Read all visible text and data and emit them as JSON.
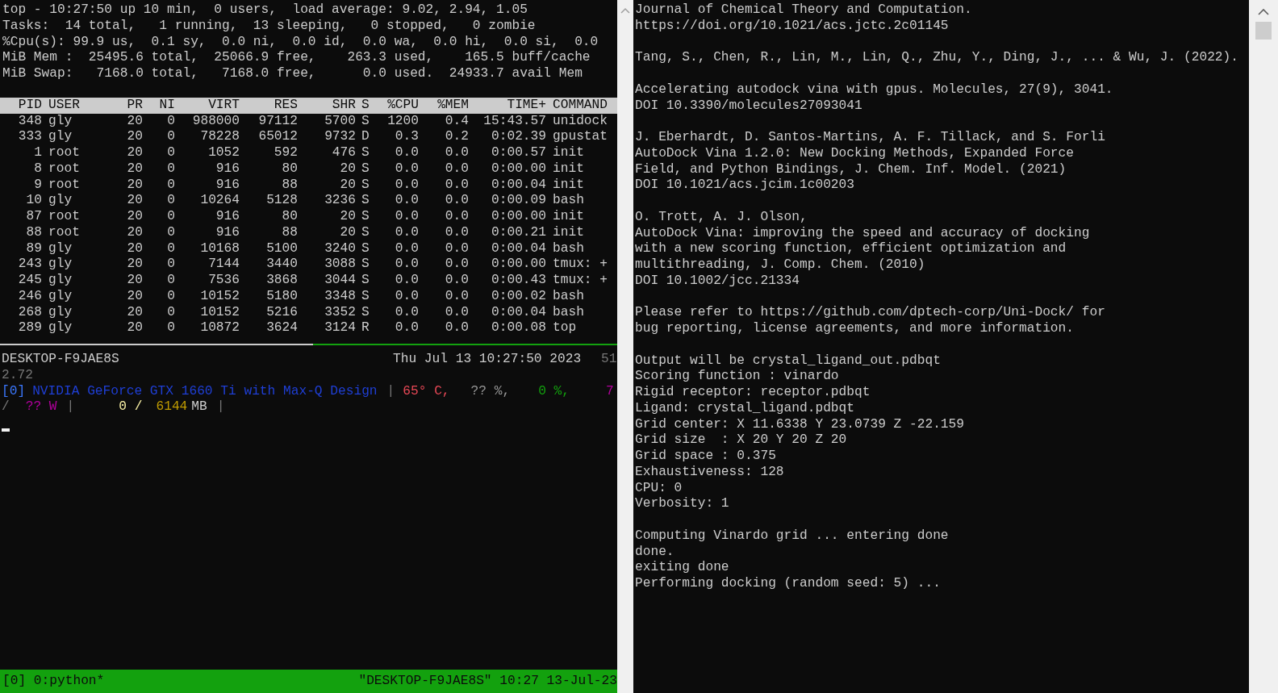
{
  "top_pane": {
    "summary": [
      "top - 10:27:50 up 10 min,  0 users,  load average: 9.02, 2.94, 1.05",
      "Tasks:  14 total,   1 running,  13 sleeping,   0 stopped,   0 zombie",
      "%Cpu(s): 99.9 us,  0.1 sy,  0.0 ni,  0.0 id,  0.0 wa,  0.0 hi,  0.0 si,  0.0",
      "MiB Mem :  25495.6 total,  25066.9 free,    263.3 used,    165.5 buff/cache",
      "MiB Swap:   7168.0 total,   7168.0 free,      0.0 used.  24933.7 avail Mem"
    ],
    "table": {
      "columns": [
        "PID",
        "USER",
        "PR",
        "NI",
        "VIRT",
        "RES",
        "SHR",
        "S",
        "%CPU",
        "%MEM",
        "TIME+",
        "COMMAND"
      ],
      "rows": [
        [
          "348",
          "gly",
          "20",
          "0",
          "988000",
          "97112",
          "5700",
          "S",
          "1200",
          "0.4",
          "15:43.57",
          "unidock"
        ],
        [
          "333",
          "gly",
          "20",
          "0",
          "78228",
          "65012",
          "9732",
          "D",
          "0.3",
          "0.2",
          "0:02.39",
          "gpustat"
        ],
        [
          "1",
          "root",
          "20",
          "0",
          "1052",
          "592",
          "476",
          "S",
          "0.0",
          "0.0",
          "0:00.57",
          "init"
        ],
        [
          "8",
          "root",
          "20",
          "0",
          "916",
          "80",
          "20",
          "S",
          "0.0",
          "0.0",
          "0:00.00",
          "init"
        ],
        [
          "9",
          "root",
          "20",
          "0",
          "916",
          "88",
          "20",
          "S",
          "0.0",
          "0.0",
          "0:00.04",
          "init"
        ],
        [
          "10",
          "gly",
          "20",
          "0",
          "10264",
          "5128",
          "3236",
          "S",
          "0.0",
          "0.0",
          "0:00.09",
          "bash"
        ],
        [
          "87",
          "root",
          "20",
          "0",
          "916",
          "80",
          "20",
          "S",
          "0.0",
          "0.0",
          "0:00.00",
          "init"
        ],
        [
          "88",
          "root",
          "20",
          "0",
          "916",
          "88",
          "20",
          "S",
          "0.0",
          "0.0",
          "0:00.21",
          "init"
        ],
        [
          "89",
          "gly",
          "20",
          "0",
          "10168",
          "5100",
          "3240",
          "S",
          "0.0",
          "0.0",
          "0:00.04",
          "bash"
        ],
        [
          "243",
          "gly",
          "20",
          "0",
          "7144",
          "3440",
          "3088",
          "S",
          "0.0",
          "0.0",
          "0:00.00",
          "tmux: +"
        ],
        [
          "245",
          "gly",
          "20",
          "0",
          "7536",
          "3868",
          "3044",
          "S",
          "0.0",
          "0.0",
          "0:00.43",
          "tmux: +"
        ],
        [
          "246",
          "gly",
          "20",
          "0",
          "10152",
          "5180",
          "3348",
          "S",
          "0.0",
          "0.0",
          "0:00.02",
          "bash"
        ],
        [
          "268",
          "gly",
          "20",
          "0",
          "10152",
          "5216",
          "3352",
          "S",
          "0.0",
          "0.0",
          "0:00.04",
          "bash"
        ],
        [
          "289",
          "gly",
          "20",
          "0",
          "10872",
          "3624",
          "3124",
          "R",
          "0.0",
          "0.0",
          "0:00.08",
          "top"
        ]
      ]
    }
  },
  "gpustat": {
    "host": "DESKTOP-F9JAE8S",
    "time": "Thu Jul 13 10:27:50 2023",
    "driver_head": "51",
    "driver_tail": "2.72",
    "line_1": [
      {
        "text": "[0]",
        "kind": "index"
      },
      {
        "text": "NVIDIA GeForce GTX 1660 Ti with Max-Q Design",
        "kind": "name"
      },
      {
        "text": "|",
        "kind": "sep"
      },
      {
        "text": "65° C,",
        "kind": "temp"
      },
      {
        "text": "?? %,",
        "kind": "unknown"
      },
      {
        "text": "0 %,",
        "kind": "util"
      },
      {
        "text": "7",
        "kind": "power"
      }
    ],
    "line_2": [
      {
        "text": "/",
        "kind": "sep"
      },
      {
        "text": "?? W",
        "kind": "power"
      },
      {
        "text": "|",
        "kind": "sep"
      },
      {
        "text": "0 /",
        "kind": "mem_used"
      },
      {
        "text": "6144",
        "kind": "mem_total"
      },
      {
        "text": "MB",
        "kind": "plain"
      },
      {
        "text": "|",
        "kind": "sep"
      }
    ]
  },
  "tmux_status": {
    "window": "[0] 0:python*",
    "right": "\"DESKTOP-F9JAE8S\" 10:27 13-Jul-23"
  },
  "output_pane": {
    "blocks": [
      [
        "Journal of Chemical Theory and Computation.",
        "https://doi.org/10.1021/acs.jctc.2c01145"
      ],
      [
        "Tang, S., Chen, R., Lin, M., Lin, Q., Zhu, Y., Ding, J., ... & Wu, J. (2022)."
      ],
      [
        "Accelerating autodock vina with gpus. Molecules, 27(9), 3041.",
        "DOI 10.3390/molecules27093041"
      ],
      [
        "J. Eberhardt, D. Santos-Martins, A. F. Tillack, and S. Forli",
        "AutoDock Vina 1.2.0: New Docking Methods, Expanded Force",
        "Field, and Python Bindings, J. Chem. Inf. Model. (2021)",
        "DOI 10.1021/acs.jcim.1c00203"
      ],
      [
        "O. Trott, A. J. Olson,",
        "AutoDock Vina: improving the speed and accuracy of docking",
        "with a new scoring function, efficient optimization and",
        "multithreading, J. Comp. Chem. (2010)",
        "DOI 10.1002/jcc.21334"
      ],
      [
        "Please refer to https://github.com/dptech-corp/Uni-Dock/ for",
        "bug reporting, license agreements, and more information."
      ],
      [
        "Output will be crystal_ligand_out.pdbqt",
        "Scoring function : vinardo",
        "Rigid receptor: receptor.pdbqt",
        "Ligand: crystal_ligand.pdbqt",
        "Grid center: X 11.6338 Y 23.0739 Z -22.159",
        "Grid size  : X 20 Y 20 Z 20",
        "Grid space : 0.375",
        "Exhaustiveness: 128",
        "CPU: 0",
        "Verbosity: 1"
      ],
      [
        "Computing Vinardo grid ... entering done",
        "done.",
        "exiting done",
        "Performing docking (random seed: 5) ..."
      ]
    ]
  }
}
